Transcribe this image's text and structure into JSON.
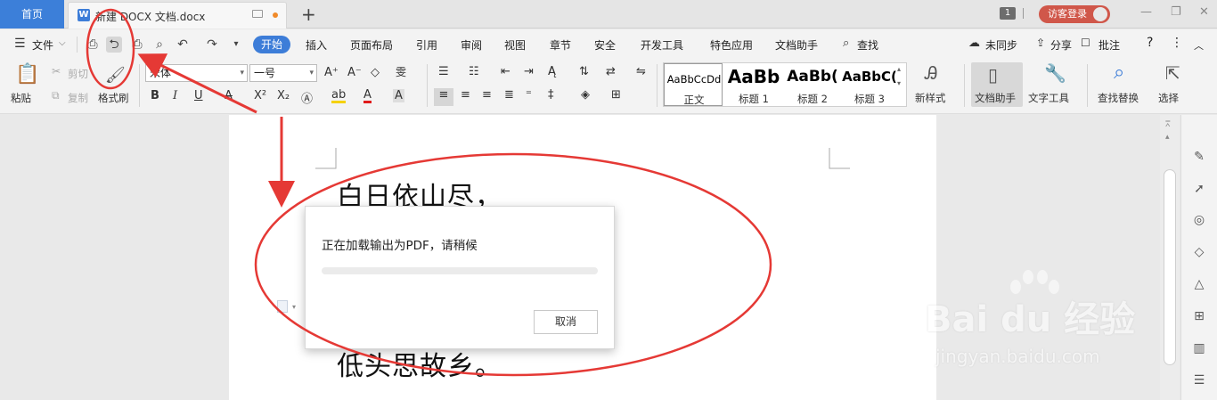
{
  "tabbar": {
    "home_label": "首页",
    "doc_icon": "W",
    "doc_title": "新建 DOCX 文档.docx",
    "new_tab": "+",
    "page_badge": "1",
    "login_label": "访客登录",
    "win_controls": [
      "—",
      "❐",
      "✕"
    ]
  },
  "menu": {
    "file_label": "文件",
    "items": [
      "开始",
      "插入",
      "页面布局",
      "引用",
      "审阅",
      "视图",
      "章节",
      "安全",
      "开发工具",
      "特色应用",
      "文档助手",
      "查找"
    ],
    "sync_label": "未同步",
    "share_label": "分享",
    "comment_label": "批注"
  },
  "ribbon": {
    "paste_label": "粘贴",
    "cut_label": "剪切",
    "copy_label": "复制",
    "format_painter_label": "格式刷",
    "font_name": "宋体",
    "font_size": "一号",
    "styles": [
      {
        "sample": "AaBbCcDd",
        "label": "正文"
      },
      {
        "sample": "AaBb",
        "label": "标题 1"
      },
      {
        "sample": "AaBb(",
        "label": "标题 2"
      },
      {
        "sample": "AaBbC(",
        "label": "标题 3"
      }
    ],
    "new_style_label": "新样式",
    "doc_assist_label": "文档助手",
    "text_tools_label": "文字工具",
    "find_replace_label": "查找替换",
    "select_label": "选择"
  },
  "document": {
    "line1": "白日依山尽，",
    "line2": "低头思故乡。"
  },
  "dialog": {
    "message": "正在加载输出为PDF，请稍候",
    "progress": 0.0,
    "cancel_label": "取消"
  },
  "watermark": {
    "logo": "Bai du 经验",
    "sub": "jingyan.baidu.com"
  },
  "colors": {
    "accent": "#3d7dd8",
    "annotation": "#e53935",
    "login": "#d0574a"
  }
}
